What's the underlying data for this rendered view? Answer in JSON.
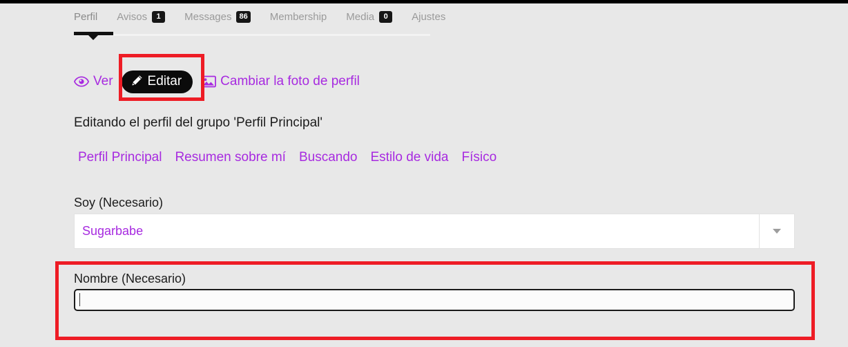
{
  "colors": {
    "accent_purple": "#a72ae0",
    "highlight_red": "#ee1c25",
    "badge_black": "#161616",
    "page_bg": "#e8e8e8"
  },
  "tabs": [
    {
      "label": "Perfil",
      "badge": null,
      "active": true
    },
    {
      "label": "Avisos",
      "badge": "1",
      "active": false
    },
    {
      "label": "Messages",
      "badge": "86",
      "active": false
    },
    {
      "label": "Membership",
      "badge": null,
      "active": false
    },
    {
      "label": "Media",
      "badge": "0",
      "active": false
    },
    {
      "label": "Ajustes",
      "badge": null,
      "active": false
    }
  ],
  "actions": {
    "ver": {
      "label": "Ver",
      "icon": "eye-icon"
    },
    "editar": {
      "label": "Editar",
      "icon": "pencil-icon",
      "state": "active"
    },
    "cambiar_foto": {
      "label": "Cambiar la foto de perfil",
      "icon": "image-icon"
    }
  },
  "heading": "Editando el perfil del grupo 'Perfil Principal'",
  "subnav": [
    {
      "label": "Perfil Principal"
    },
    {
      "label": "Resumen sobre mí"
    },
    {
      "label": "Buscando"
    },
    {
      "label": "Estilo de vida"
    },
    {
      "label": "Físico"
    }
  ],
  "form": {
    "soy": {
      "label": "Soy (Necesario)",
      "value": "Sugarbabe"
    },
    "nombre": {
      "label": "Nombre (Necesario)",
      "value": "",
      "placeholder": ""
    }
  }
}
